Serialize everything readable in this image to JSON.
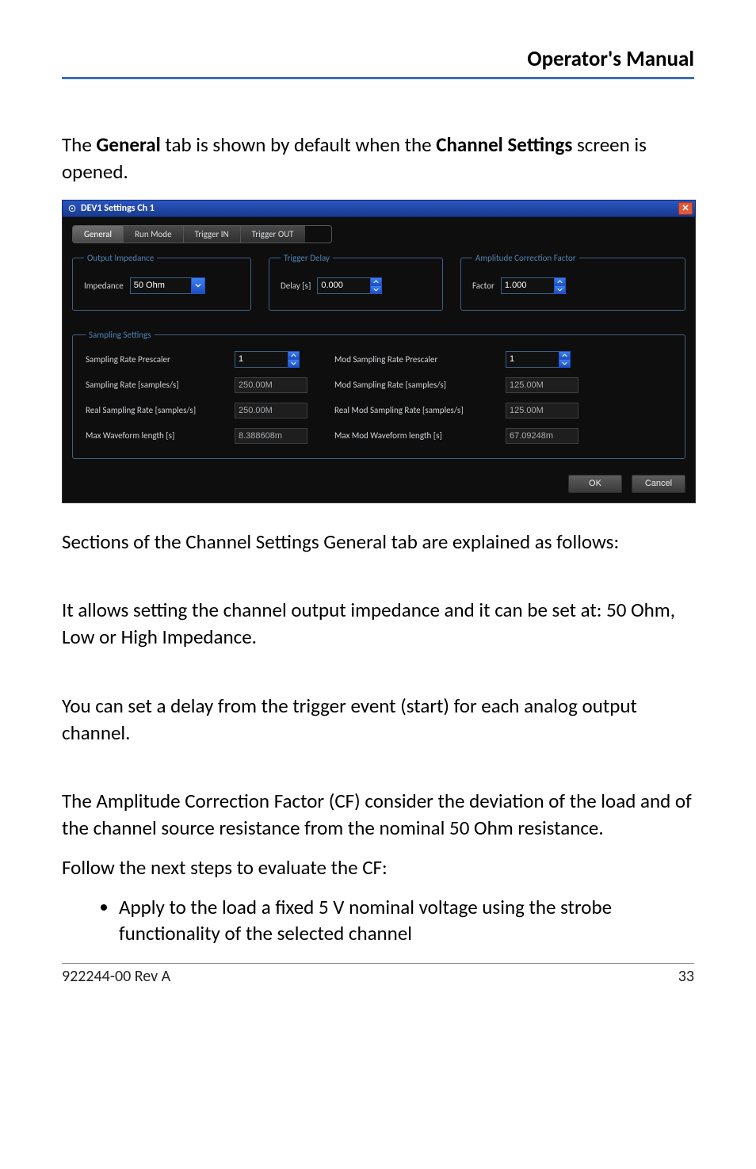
{
  "header": {
    "title": "Operator's Manual"
  },
  "intro": {
    "prefix": "The ",
    "bold1": "General",
    "mid": " tab is shown by default when the ",
    "bold2": "Channel Settings",
    "suffix": " screen is opened."
  },
  "dialog": {
    "title": "DEV1 Settings Ch 1",
    "tabs": [
      "General",
      "Run Mode",
      "Trigger IN",
      "Trigger OUT"
    ],
    "active_tab_index": 0,
    "groups": {
      "impedance": {
        "legend": "Output Impedance",
        "label": "Impedance",
        "value": "50 Ohm"
      },
      "delay": {
        "legend": "Trigger Delay",
        "label": "Delay [s]",
        "value": "0.000"
      },
      "amp": {
        "legend": "Amplitude Correction Factor",
        "label": "Factor",
        "value": "1.000"
      }
    },
    "sampling": {
      "legend": "Sampling Settings",
      "rows": [
        {
          "l1": "Sampling Rate Prescaler",
          "v1": "1",
          "l2": "Mod Sampling Rate Prescaler",
          "v2": "1",
          "spin": true
        },
        {
          "l1": "Sampling Rate [samples/s]",
          "v1": "250.00M",
          "l2": "Mod Sampling Rate [samples/s]",
          "v2": "125.00M",
          "spin": false
        },
        {
          "l1": "Real Sampling Rate [samples/s]",
          "v1": "250.00M",
          "l2": "Real Mod Sampling Rate [samples/s]",
          "v2": "125.00M",
          "spin": false
        },
        {
          "l1": "Max Waveform length [s]",
          "v1": "8.388608m",
          "l2": "Max Mod Waveform length [s]",
          "v2": "67.09248m",
          "spin": false
        }
      ]
    },
    "buttons": {
      "ok": "OK",
      "cancel": "Cancel"
    }
  },
  "para1": "Sections of the Channel Settings General tab are explained as follows:",
  "para2": "It allows setting the channel output impedance and it can be set at: 50 Ohm, Low or High Impedance.",
  "para3": "You can set a delay from the trigger event (start) for each analog output channel.",
  "para4": "The Amplitude Correction Factor (CF) consider the deviation of the load and of the channel source resistance from the nominal 50 Ohm resistance.",
  "para5": "Follow the next steps to evaluate the CF:",
  "bullet1": "Apply to the load a fixed 5 V nominal voltage using the strobe functionality of the selected channel",
  "footer": {
    "left": "922244-00 Rev A",
    "right": "33"
  }
}
